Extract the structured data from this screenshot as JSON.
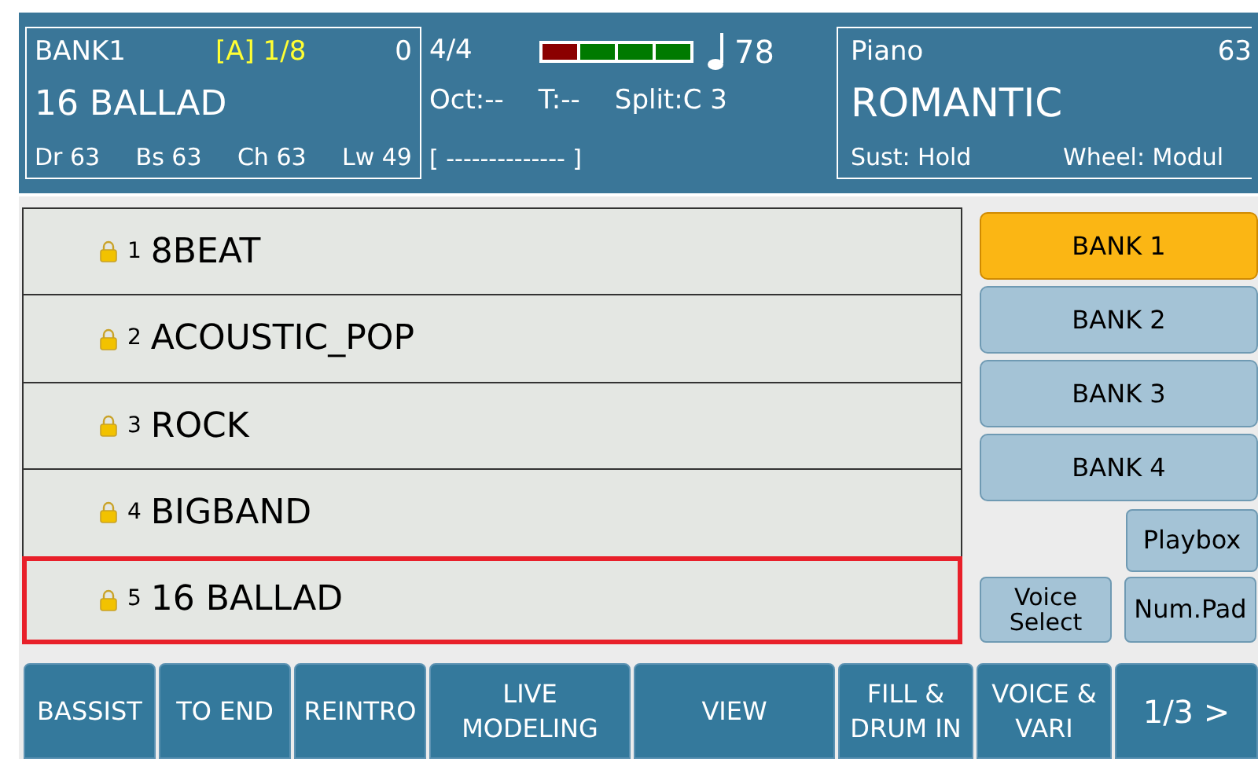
{
  "header": {
    "bank": "BANK1",
    "variation": "[A] 1/8",
    "counter": "0",
    "style_name": "16 BALLAD",
    "volumes": [
      "Dr 63",
      "Bs 63",
      "Ch 63",
      "Lw 49"
    ],
    "time_signature": "4/4",
    "beats": [
      {
        "color": "#8b0000"
      },
      {
        "color": "#007a00"
      },
      {
        "color": "#007a00"
      },
      {
        "color": "#007a00"
      }
    ],
    "tempo": "78",
    "octave": "Oct:--",
    "transpose": "T:--",
    "split": "Split:C 3",
    "chord": "[ -------------- ]",
    "voice_group": "Piano",
    "voice_number": "63",
    "voice_name": "ROMANTIC",
    "sustain": "Sust: Hold",
    "wheel": "Wheel: Modul"
  },
  "styles": [
    {
      "number": "1",
      "name": "8BEAT",
      "selected": false
    },
    {
      "number": "2",
      "name": "ACOUSTIC_POP",
      "selected": false
    },
    {
      "number": "3",
      "name": "ROCK",
      "selected": false
    },
    {
      "number": "4",
      "name": "BIGBAND",
      "selected": false
    },
    {
      "number": "5",
      "name": "16 BALLAD",
      "selected": true
    }
  ],
  "banks": [
    {
      "label": "BANK 1",
      "selected": true
    },
    {
      "label": "BANK 2",
      "selected": false
    },
    {
      "label": "BANK 3",
      "selected": false
    },
    {
      "label": "BANK 4",
      "selected": false
    }
  ],
  "side_buttons": {
    "playbox": "Playbox",
    "voice_select": "Voice Select",
    "num_pad": "Num.Pad"
  },
  "bottom_buttons": [
    "BASSIST",
    "TO END",
    "REINTRO",
    "LIVE MODELING",
    "VIEW",
    "FILL & DRUM IN",
    "VOICE & VARI",
    "1/3 >"
  ]
}
